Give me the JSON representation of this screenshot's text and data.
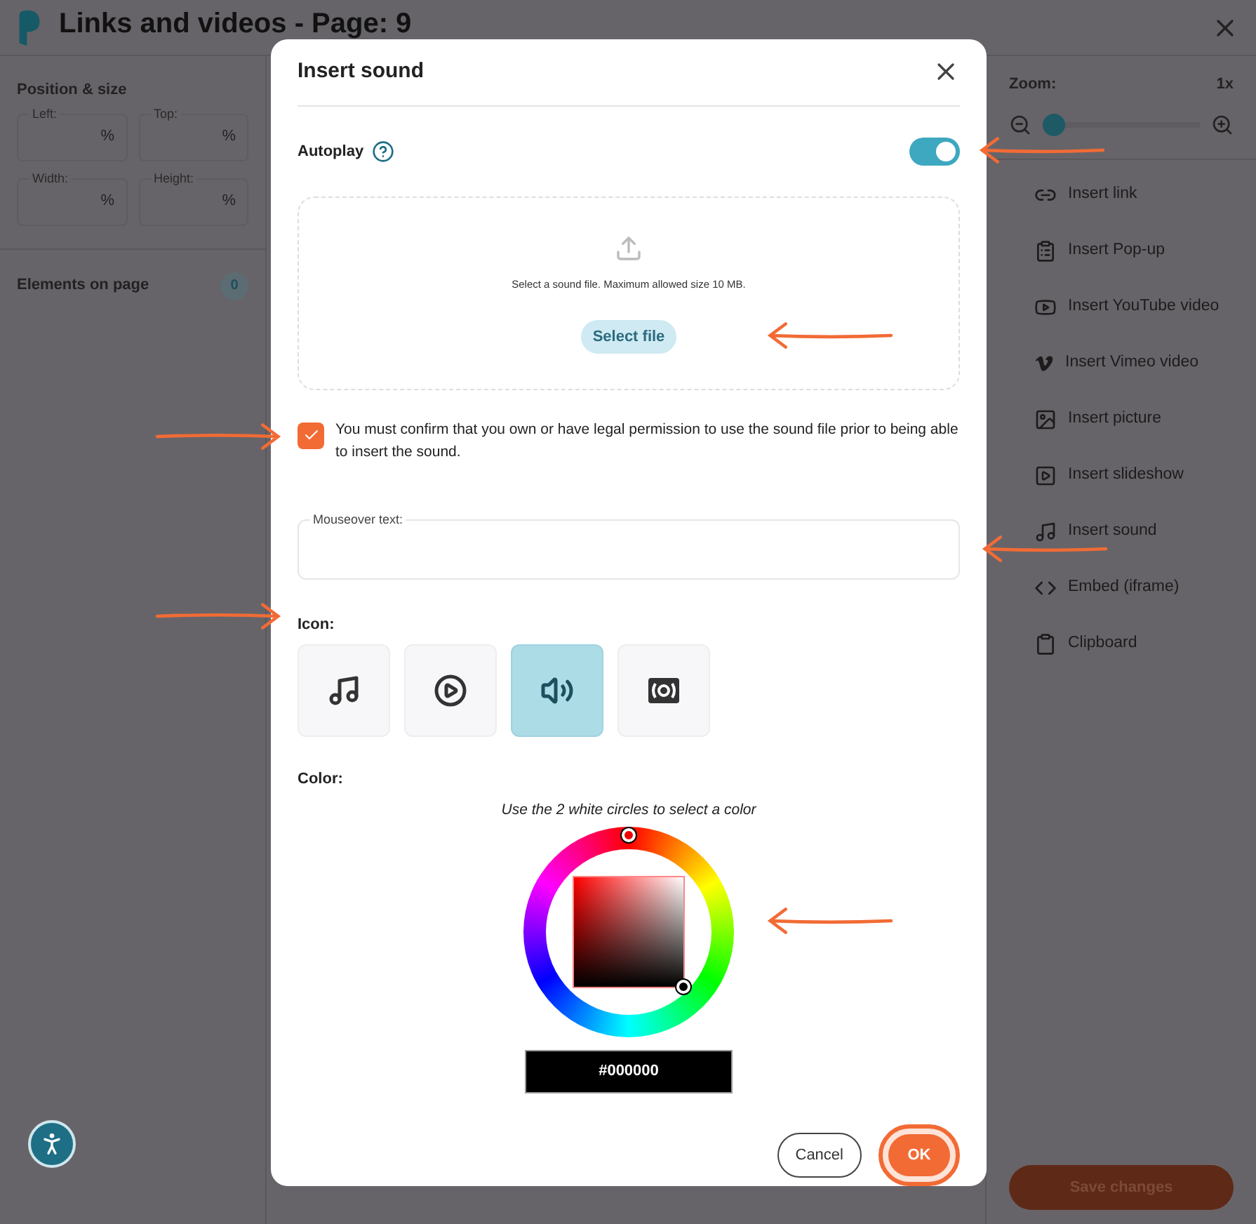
{
  "header": {
    "title": "Links and videos - Page: 9"
  },
  "left_panel": {
    "section_title": "Position & size",
    "fields": [
      {
        "label": "Left:",
        "unit": "%"
      },
      {
        "label": "Top:",
        "unit": "%"
      },
      {
        "label": "Width:",
        "unit": "%"
      },
      {
        "label": "Height:",
        "unit": "%"
      }
    ],
    "elements_title": "Elements on page",
    "elements_count": "0"
  },
  "right_panel": {
    "zoom_label": "Zoom:",
    "zoom_value": "1x",
    "zoom": {
      "level": 0
    },
    "items": [
      {
        "kind": "link",
        "label": "Insert link"
      },
      {
        "kind": "popup",
        "label": "Insert Pop-up"
      },
      {
        "kind": "youtube",
        "label": "Insert YouTube video"
      },
      {
        "kind": "vimeo",
        "label": "Insert Vimeo video"
      },
      {
        "kind": "picture",
        "label": "Insert picture"
      },
      {
        "kind": "slideshow",
        "label": "Insert slideshow"
      },
      {
        "kind": "sound",
        "label": "Insert sound"
      },
      {
        "kind": "embed",
        "label": "Embed (iframe)"
      },
      {
        "kind": "clipboard",
        "label": "Clipboard"
      }
    ],
    "save_button": "Save changes"
  },
  "dialog": {
    "title": "Insert sound",
    "autoplay": {
      "label": "Autoplay",
      "on": true
    },
    "upload": {
      "hint": "Select a sound file. Maximum allowed size 10 MB.",
      "button": "Select file"
    },
    "confirm": {
      "checked": true,
      "text": "You must confirm that you own or have legal permission to use the sound file prior to being able to insert the sound."
    },
    "mouseover": {
      "label": "Mouseover text:"
    },
    "icon_label": "Icon:",
    "icons": [
      {
        "kind": "note",
        "selected": false
      },
      {
        "kind": "play",
        "selected": false
      },
      {
        "kind": "speaker",
        "selected": true
      },
      {
        "kind": "broadcast",
        "selected": false
      }
    ],
    "color_label": "Color:",
    "color_hint": "Use the 2 white circles to select a color",
    "color_value": "#000000",
    "cancel": "Cancel",
    "ok": "OK"
  }
}
